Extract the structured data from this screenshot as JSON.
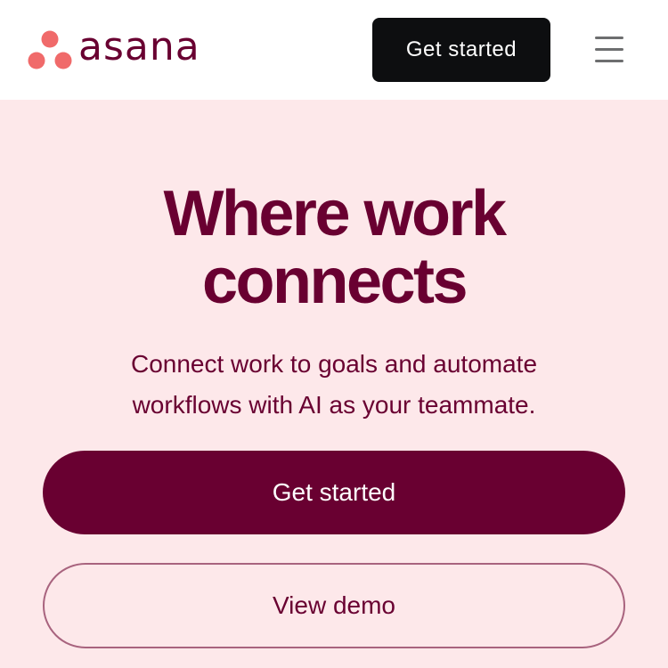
{
  "header": {
    "logo_text": "asana",
    "logo_icon": "asana-logo-icon",
    "cta_label": "Get started",
    "menu_icon": "hamburger-menu-icon"
  },
  "hero": {
    "title_line1": "Where work",
    "title_line2": "connects",
    "subtitle_line1": "Connect work to goals and automate",
    "subtitle_line2": "workflows with AI as your teammate.",
    "primary_cta": "Get started",
    "secondary_cta": "View demo"
  },
  "colors": {
    "brand_dark": "#690031",
    "logo_coral": "#f06a6a",
    "hero_bg": "#fde8ea",
    "header_cta_bg": "#0d0e10",
    "menu_gray": "#6d6e6f"
  }
}
